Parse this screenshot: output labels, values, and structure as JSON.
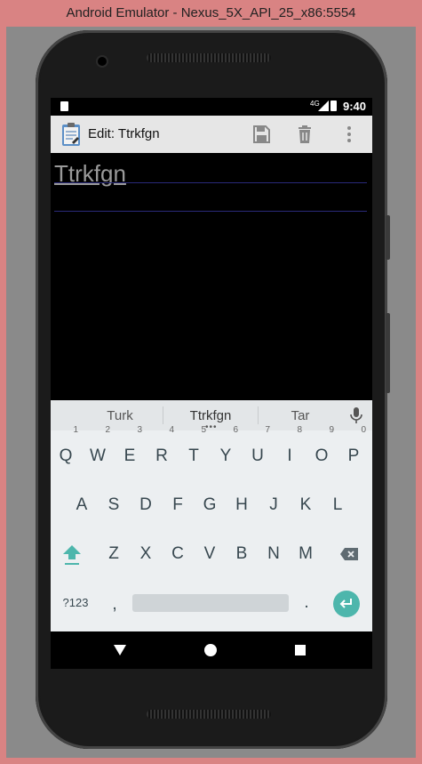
{
  "window": {
    "title": "Android Emulator - Nexus_5X_API_25_x86:5554"
  },
  "status_bar": {
    "network": "4G",
    "time": "9:40"
  },
  "toolbar": {
    "title": "Edit: Ttrkfgn",
    "save_icon": "save-icon",
    "delete_icon": "trash-icon",
    "menu_icon": "overflow-menu-icon"
  },
  "editor": {
    "text": "Ttrkfgn"
  },
  "keyboard": {
    "suggestions": [
      "Turk",
      "Ttrkfgn",
      "Tar"
    ],
    "row1": [
      {
        "key": "Q",
        "hint": "1"
      },
      {
        "key": "W",
        "hint": "2"
      },
      {
        "key": "E",
        "hint": "3"
      },
      {
        "key": "R",
        "hint": "4"
      },
      {
        "key": "T",
        "hint": "5"
      },
      {
        "key": "Y",
        "hint": "6"
      },
      {
        "key": "U",
        "hint": "7"
      },
      {
        "key": "I",
        "hint": "8"
      },
      {
        "key": "O",
        "hint": "9"
      },
      {
        "key": "P",
        "hint": "0"
      }
    ],
    "row2": [
      "A",
      "S",
      "D",
      "F",
      "G",
      "H",
      "J",
      "K",
      "L"
    ],
    "row3": [
      "Z",
      "X",
      "C",
      "V",
      "B",
      "N",
      "M"
    ],
    "symbols_label": "?123",
    "comma": ",",
    "period": ".",
    "accent_color": "#4db6ac"
  }
}
